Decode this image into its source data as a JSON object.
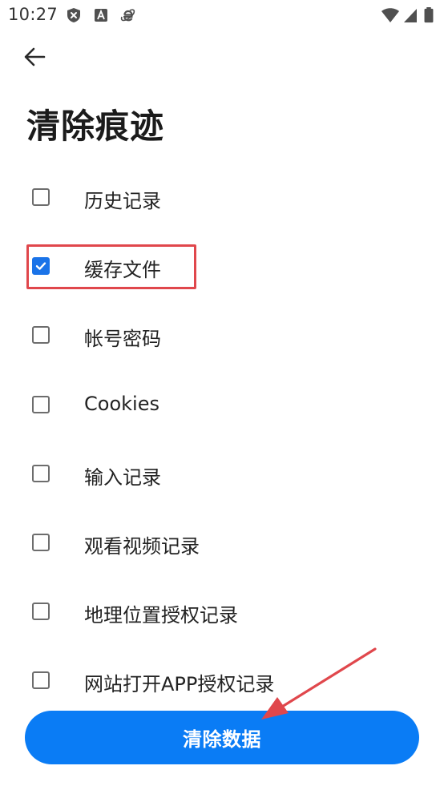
{
  "status_bar": {
    "time": "10:27",
    "left_icons": [
      "shield-x-icon",
      "font-a-icon",
      "browser-e-icon"
    ],
    "right_icons": [
      "wifi-icon",
      "cellular-signal-icon",
      "battery-icon"
    ]
  },
  "header": {
    "back_icon": "arrow-left-icon",
    "title": "清除痕迹"
  },
  "options": [
    {
      "label": "历史记录",
      "checked": false
    },
    {
      "label": "缓存文件",
      "checked": true
    },
    {
      "label": "帐号密码",
      "checked": false
    },
    {
      "label": "Cookies",
      "checked": false
    },
    {
      "label": "输入记录",
      "checked": false
    },
    {
      "label": "观看视频记录",
      "checked": false
    },
    {
      "label": "地理位置授权记录",
      "checked": false
    },
    {
      "label": "网站打开APP授权记录",
      "checked": false
    }
  ],
  "actions": {
    "clear_label": "清除数据"
  },
  "colors": {
    "accent": "#0a7cf5",
    "checkbox_checked": "#1a73e8",
    "annotation": "#e0474c",
    "text": "#202020"
  }
}
